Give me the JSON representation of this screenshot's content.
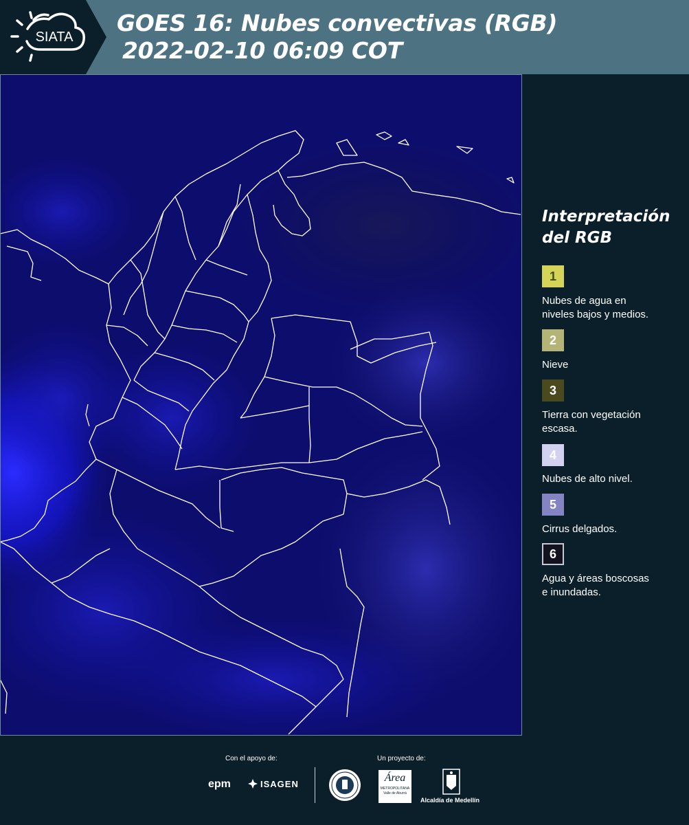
{
  "header": {
    "logo_text": "SIATA",
    "title_line1": "GOES 16: Nubes convectivas (RGB)",
    "title_line2": "2022-02-10 06:09 COT"
  },
  "legend": {
    "title_line1": "Interpretación",
    "title_line2": "del RGB",
    "items": [
      {
        "number": "1",
        "color": "#d4d458",
        "label_lines": [
          "Nubes de agua en",
          "niveles bajos y medios."
        ]
      },
      {
        "number": "2",
        "color": "#b4b476",
        "label_lines": [
          "Nieve"
        ]
      },
      {
        "number": "3",
        "color": "#4a4a1e",
        "label_lines": [
          "Tierra con vegetación",
          "escasa."
        ]
      },
      {
        "number": "4",
        "color": "#d2d2f0",
        "label_lines": [
          "Nubes de alto nivel."
        ]
      },
      {
        "number": "5",
        "color": "#8484c4",
        "label_lines": [
          "Cirrus delgados."
        ]
      },
      {
        "number": "6",
        "color": "#13131f",
        "label_lines": [
          "Agua y áreas boscosas",
          "e inundadas."
        ]
      }
    ]
  },
  "footer": {
    "support_label": "Con el apoyo de:",
    "project_label": "Un proyecto de:",
    "logos": {
      "epm": "epm",
      "isagen": "ISAGEN",
      "area_metropolitana": "Área",
      "area_metropolitana_sub1": "METROPOLITANA",
      "area_metropolitana_sub2": "Valle de Aburrá",
      "alcaldia": "Alcaldía de Medellín"
    }
  },
  "colors": {
    "header_bg": "#4d7281",
    "page_bg": "#0b1f2a",
    "map_bg": "#0d0d6e",
    "border_lines": "#ffffff"
  }
}
